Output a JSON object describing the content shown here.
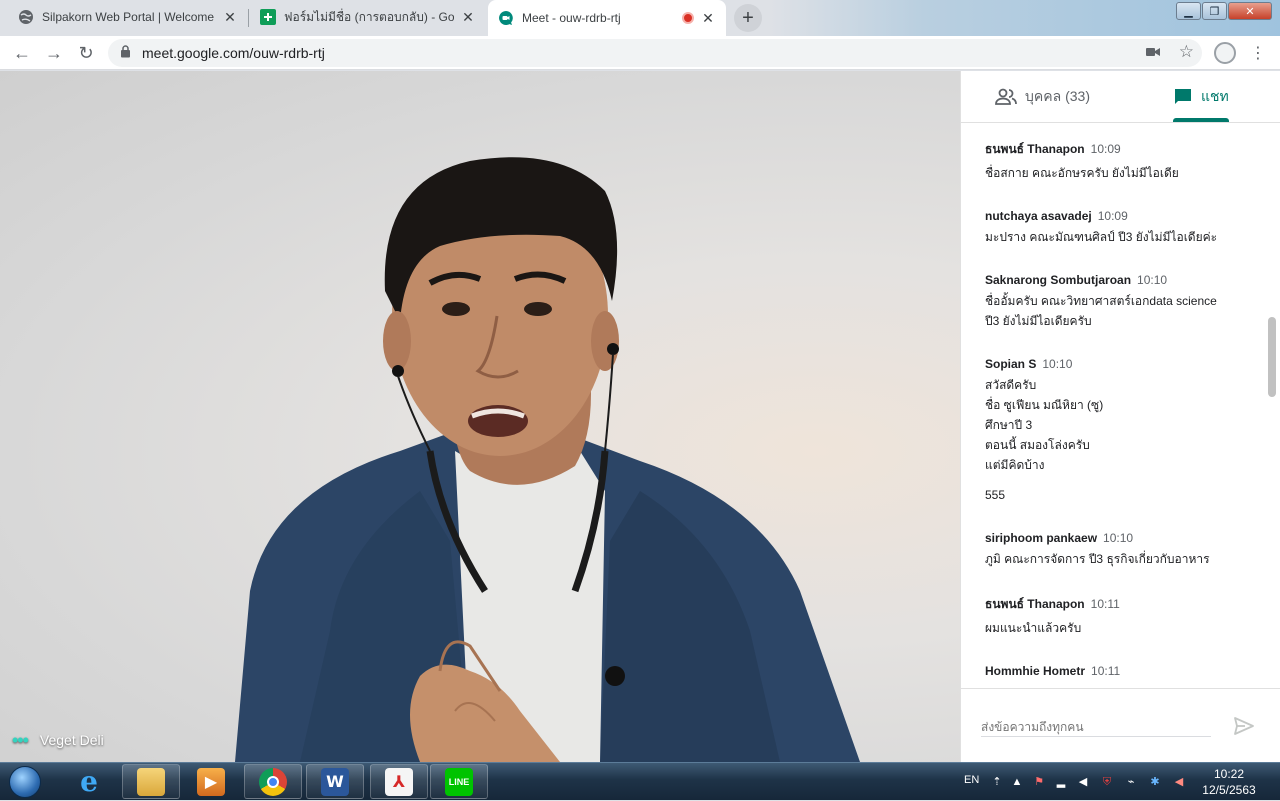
{
  "browser": {
    "tabs": [
      {
        "title": "Silpakorn Web Portal | Welcome",
        "active": false
      },
      {
        "title": "ฟอร์มไม่มีชื่อ (การตอบกลับ) - Google",
        "active": false
      },
      {
        "title": "Meet - ouw-rdrb-rtj",
        "active": true,
        "recording": true
      }
    ],
    "new_tab_label": "+",
    "url": "meet.google.com/ouw-rdrb-rtj"
  },
  "video": {
    "participant_name": "Veget Deli"
  },
  "panel": {
    "people_tab": "บุคคล (33)",
    "chat_tab": "แชท",
    "active_tab": "chat",
    "messages": [
      {
        "sender": "ธนพนธ์ Thanapon",
        "time": "10:09",
        "lines": [
          "ชื่อสกาย คณะอักษรครับ ยังไม่มีไอเดีย"
        ]
      },
      {
        "sender": "nutchaya asavadej",
        "time": "10:09",
        "lines": [
          "มะปราง คณะมัณฑนศิลป์  ปี3 ยังไม่มีไอเดียค่ะ"
        ]
      },
      {
        "sender": "Saknarong Sombutjaroan",
        "time": "10:10",
        "lines": [
          "ชื่ออั้มครับ คณะวิทยาศาสตร์เอกdata science",
          "ปี3 ยังไม่มีไอเดียครับ"
        ]
      },
      {
        "sender": "Sopian S",
        "time": "10:10",
        "lines": [
          "สวัสดีครับ",
          "ชื่อ ซูเฟียน มณีหิยา (ซู)",
          "ศึกษาปี 3",
          "ตอนนี้ สมองโล่งครับ",
          "แต่มีคิดบ้าง"
        ],
        "extra": "555"
      },
      {
        "sender": "siriphoom pankaew",
        "time": "10:10",
        "lines": [
          "ภูมิ คณะการจัดการ ปี3 ธุรกิจเกี่ยวกับอาหาร"
        ]
      },
      {
        "sender": "ธนพนธ์ Thanapon",
        "time": "10:11",
        "lines": [
          "ผมแนะนำแล้วครับ"
        ]
      },
      {
        "sender": "Hommhie Hometr",
        "time": "10:11",
        "lines": []
      }
    ],
    "composer_placeholder": "ส่งข้อความถึงทุกคน"
  },
  "taskbar": {
    "apps": [
      "internet-explorer",
      "file-explorer",
      "media-player",
      "chrome",
      "word",
      "acrobat",
      "line"
    ],
    "language": "EN",
    "time": "10:22",
    "date": "12/5/2563"
  },
  "colors": {
    "accent": "#00796b",
    "record": "#d93025",
    "jacket": "#2c4566"
  }
}
